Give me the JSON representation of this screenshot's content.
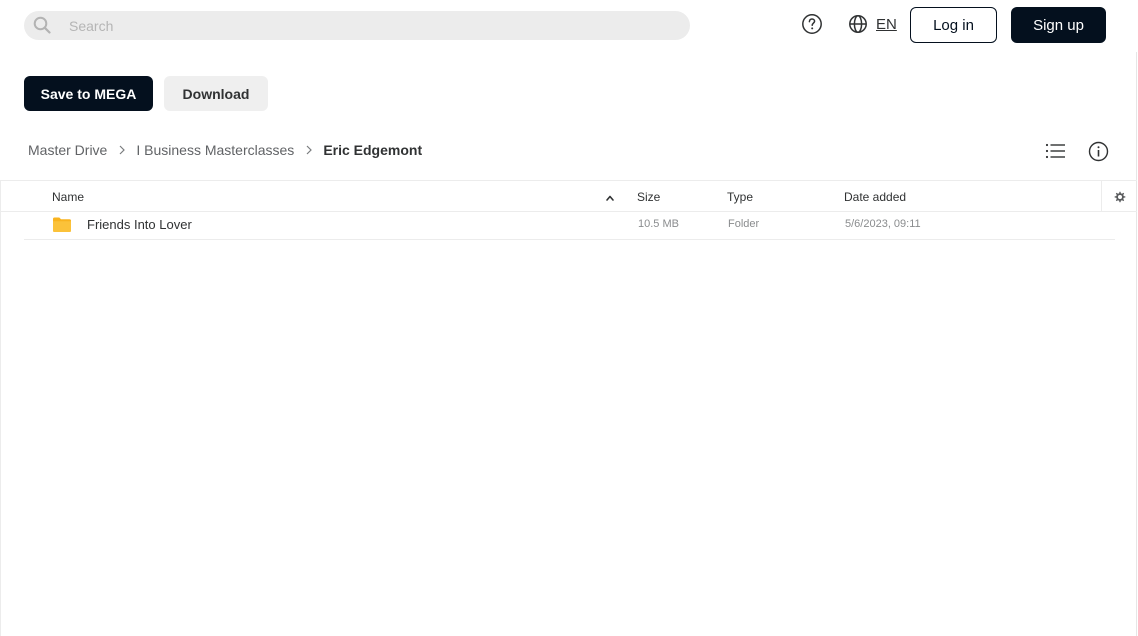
{
  "header": {
    "search_placeholder": "Search",
    "language_code": "EN",
    "login_label": "Log in",
    "signup_label": "Sign up"
  },
  "actions": {
    "save_label": "Save to MEGA",
    "download_label": "Download"
  },
  "breadcrumb": {
    "items": [
      "Master Drive",
      "I Business Masterclasses",
      "Eric Edgemont"
    ]
  },
  "table": {
    "columns": {
      "name": "Name",
      "size": "Size",
      "type": "Type",
      "date": "Date added"
    },
    "sort": "name-ascending",
    "rows": [
      {
        "name": "Friends Into Lover",
        "size": "10.5 MB",
        "type": "Folder",
        "date": "5/6/2023, 09:11",
        "icon": "folder-icon"
      }
    ]
  },
  "colors": {
    "primary_dark": "#04101e",
    "folder_yellow": "#f9b31e",
    "search_bg": "#ececec",
    "secondary_button_bg": "#efefef"
  },
  "icons": {
    "search": "search-icon",
    "help": "help-circle-icon",
    "language": "globe-icon",
    "breadcrumb_separator": "chevron-right-icon",
    "list_view": "list-view-icon",
    "info": "info-icon",
    "sort": "chevron-up-icon",
    "column_settings": "gear-icon"
  }
}
